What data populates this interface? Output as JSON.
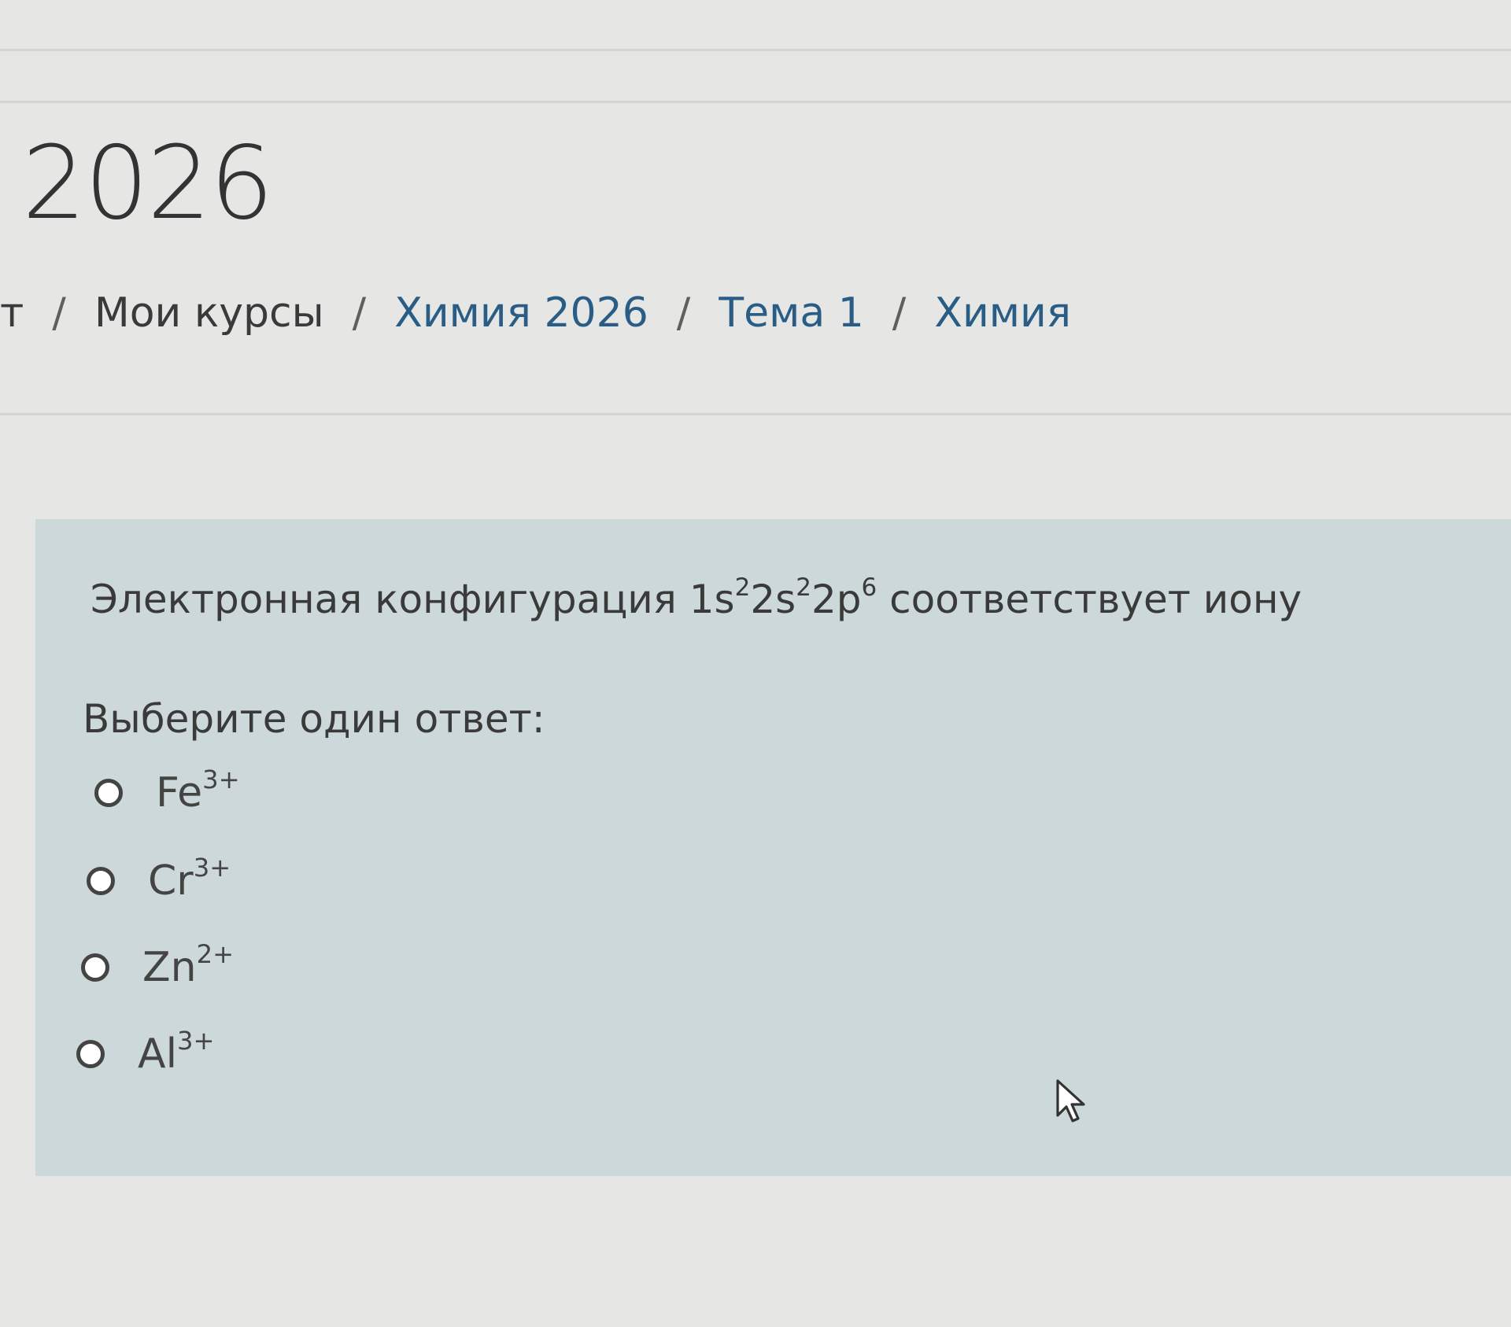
{
  "header": {
    "title": "2026",
    "breadcrumb": {
      "truncated_start": "т",
      "separator": "/",
      "items": [
        {
          "label": "Мои курсы"
        },
        {
          "label": "Химия 2026"
        },
        {
          "label": "Тема 1"
        },
        {
          "label": "Химия"
        }
      ]
    }
  },
  "question": {
    "text_before": "Электронная конфигурация ",
    "formula": {
      "t1": "1s",
      "s1": "2",
      "t2": "2s",
      "s2": "2",
      "t3": "2p",
      "s3": "6"
    },
    "text_after": " соответствует иону",
    "prompt": "Выберите один ответ:",
    "answers": [
      {
        "base": "Fe",
        "charge": "3+",
        "selected": false
      },
      {
        "base": "Cr",
        "charge": "3+",
        "selected": false
      },
      {
        "base": "Zn",
        "charge": "2+",
        "selected": false
      },
      {
        "base": "Al",
        "charge": "3+",
        "selected": false
      }
    ]
  },
  "icons": {
    "cursor": "mouse-pointer-icon",
    "radio": "radio-button-icon"
  },
  "colors": {
    "page_bg": "#e6e6e4",
    "card_bg": "#cdd8da",
    "link": "#2a5d86",
    "text": "#3a3a3a"
  }
}
